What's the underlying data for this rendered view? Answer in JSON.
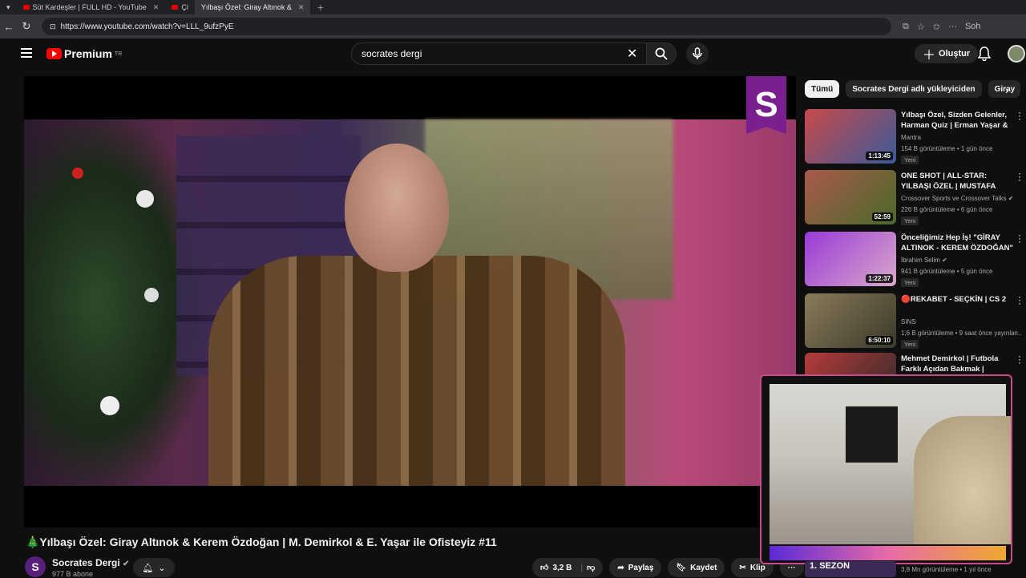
{
  "browser": {
    "tabs": [
      {
        "label": "Süt Kardeşler | FULL HD - YouTube",
        "active": false
      },
      {
        "label": "Çi",
        "active": false
      },
      {
        "label": "Yılbaşı Özel: Giray Altınok &",
        "active": true
      }
    ],
    "url": "https://www.youtube.com/watch?v=LLL_9ufzPyE",
    "profile_label": "Soh"
  },
  "header": {
    "logo_text": "Premium",
    "logo_sup": "TR",
    "search_value": "socrates dergi",
    "create_label": "Oluştur"
  },
  "video": {
    "title": "🎄Yılbaşı Özel: Giray Altınok & Kerem Özdoğan | M. Demirkol & E. Yaşar ile Ofisteyiz #11",
    "channel_logo_letter": "S",
    "channel": "Socrates Dergi",
    "channel_initial": "S",
    "subscribers": "977 B abone",
    "likes": "3,2 B",
    "share_label": "Paylaş",
    "save_label": "Kaydet",
    "clip_label": "Klip",
    "more_label": "···"
  },
  "chips": [
    "Tümü",
    "Socrates Dergi adlı yükleyiciden",
    "Giray"
  ],
  "recommendations": [
    {
      "title": "Yılbaşı Özel, Sizden Gelenler, Harman Quiz | Erman Yaşar & ...",
      "channel": "Mantra",
      "meta": "154 B görüntüleme • 1 gün önce",
      "badge": "Yeni",
      "duration": "1:13:45",
      "thumb_color": "#b83a3a"
    },
    {
      "title": "ONE SHOT | ALL-STAR: YILBAŞI ÖZEL | MUSTAFA DEMİRTAŞ, ...",
      "channel": "Crossover Sports ve Crossover Talks",
      "meta": "226 B görüntüleme • 6 gün önce",
      "badge": "Yeni",
      "duration": "52:59",
      "thumb_color": "#8a4a3a"
    },
    {
      "title": "Önceliğimiz Hep İş! \"GİRAY ALTINOK - KEREM ÖZDOĞAN\" ...",
      "channel": "İbrahim Selim",
      "meta": "941 B görüntüleme • 5 gün önce",
      "badge": "Yeni",
      "duration": "1:22:37",
      "thumb_color": "#7a3ab8"
    },
    {
      "title": "🔴REKABET - SEÇKİN | CS 2",
      "channel": "SINS",
      "meta": "1,6 B görüntüleme • 9 saat önce yayınlan...",
      "badge": "Yeni",
      "duration": "6:50:10",
      "thumb_color": "#6a5a3a"
    },
    {
      "title": "Mehmet Demirkol | Futbola Farklı Açıdan Bakmak | Kimsin...",
      "channel": "",
      "meta": "",
      "badge": "",
      "duration": "",
      "thumb_color": "#3a2a2a"
    }
  ],
  "bottom_rec": {
    "label": "1. SEZON",
    "meta": "3,8 Mn görüntüleme • 1 yıl önce"
  }
}
